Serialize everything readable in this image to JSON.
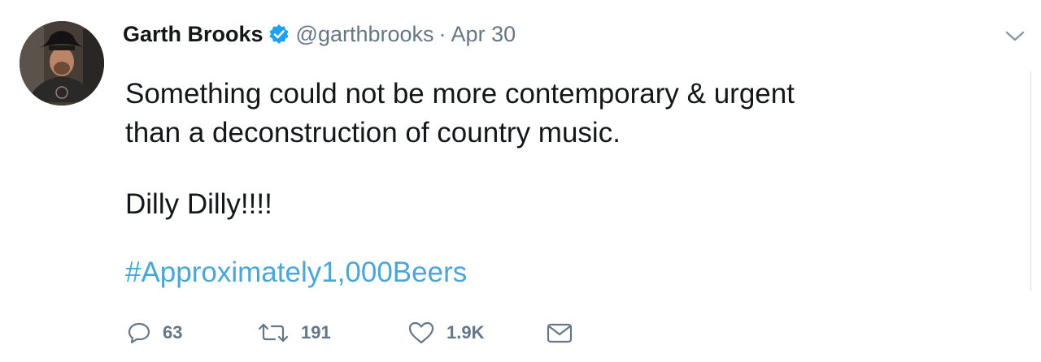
{
  "tweet": {
    "author": {
      "name": "Garth Brooks",
      "handle": "@garthbrooks",
      "verified": true
    },
    "separator": "·",
    "date": "Apr 30",
    "text_lines": [
      "Something could not be more contemporary & urgent",
      "than a deconstruction of country music."
    ],
    "text_line3": "Dilly Dilly!!!!",
    "hashtag": "#Approximately1,000Beers",
    "actions": {
      "replies": "63",
      "retweets": "191",
      "likes": "1.9K"
    }
  },
  "icons": {
    "verified": "verified-badge-icon",
    "menu": "chevron-down-icon",
    "reply": "reply-icon",
    "retweet": "retweet-icon",
    "like": "heart-icon",
    "message": "envelope-icon"
  },
  "colors": {
    "text": "#14171a",
    "secondary": "#657786",
    "link": "#48a6d9",
    "verified": "#1da1f2"
  }
}
